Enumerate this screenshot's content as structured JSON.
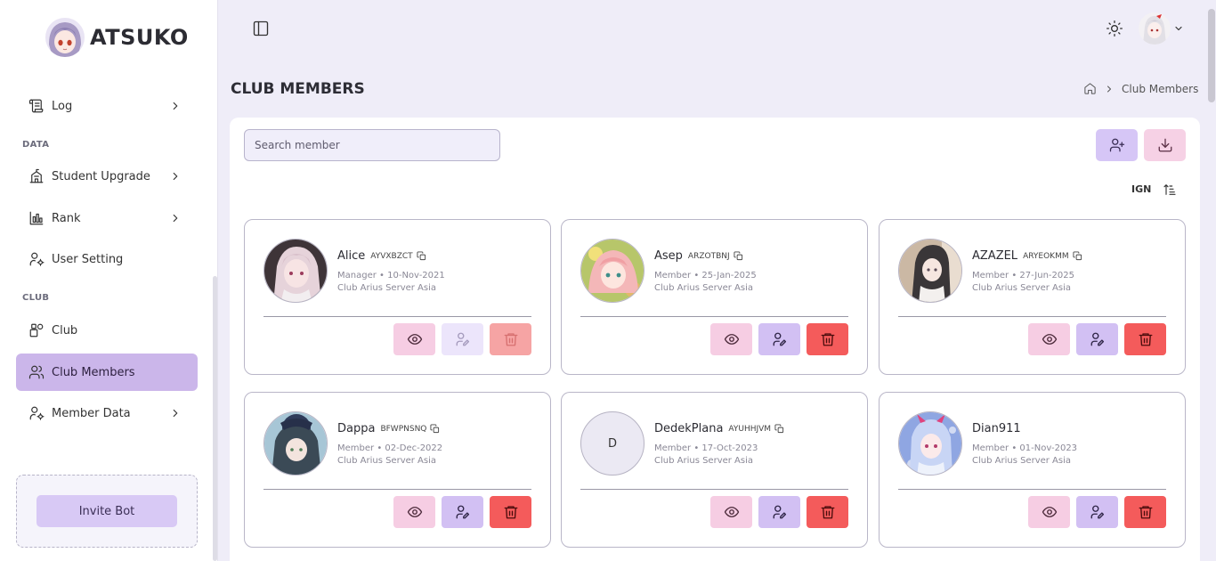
{
  "app": {
    "name": "ATSUKO"
  },
  "sidebar": {
    "items": [
      {
        "label": "Log",
        "icon": "scroll-icon",
        "chevron": true
      },
      {
        "section": "DATA"
      },
      {
        "label": "Student Upgrade",
        "icon": "school-icon",
        "chevron": true
      },
      {
        "label": "Rank",
        "icon": "bar-chart-icon",
        "chevron": true
      },
      {
        "label": "User Setting",
        "icon": "user-gear-icon",
        "chevron": false
      },
      {
        "section": "CLUB"
      },
      {
        "label": "Club",
        "icon": "shapes-icon",
        "chevron": false
      },
      {
        "label": "Club Members",
        "icon": "users-icon",
        "chevron": false,
        "active": true
      },
      {
        "label": "Member Data",
        "icon": "user-gear-icon",
        "chevron": true
      }
    ],
    "invite_label": "Invite Bot"
  },
  "page": {
    "title": "CLUB MEMBERS",
    "breadcrumb": "Club Members"
  },
  "toolbar": {
    "search_placeholder": "Search member",
    "sort_label": "IGN"
  },
  "members": [
    {
      "name": "Alice",
      "id": "AYVXBZCT",
      "role": "Manager",
      "date": "10-Nov-2021",
      "club": "Club Arius Server Asia",
      "avatar": "photo",
      "actions_disabled": true
    },
    {
      "name": "Asep",
      "id": "ARZOTBNJ",
      "role": "Member",
      "date": "25-Jan-2025",
      "club": "Club Arius Server Asia",
      "avatar": "photo",
      "actions_disabled": false
    },
    {
      "name": "AZAZEL",
      "id": "ARYEOKMM",
      "role": "Member",
      "date": "27-Jun-2025",
      "club": "Club Arius Server Asia",
      "avatar": "photo",
      "actions_disabled": false
    },
    {
      "name": "Dappa",
      "id": "BFWPNSNQ",
      "role": "Member",
      "date": "02-Dec-2022",
      "club": "Club Arius Server Asia",
      "avatar": "photo",
      "actions_disabled": false
    },
    {
      "name": "DedekPlana",
      "id": "AYUHHJVM",
      "role": "Member",
      "date": "17-Oct-2023",
      "club": "Club Arius Server Asia",
      "avatar": "D",
      "actions_disabled": false
    },
    {
      "name": "Dian911",
      "id": "",
      "role": "Member",
      "date": "01-Nov-2023",
      "club": "Club Arius Server Asia",
      "avatar": "photo",
      "actions_disabled": false
    }
  ],
  "meta_separator": " • ",
  "colors": {
    "accent": "#cbb6ea",
    "view": "#f6cde3",
    "edit": "#d2c0f3",
    "delete": "#f45b5b"
  }
}
